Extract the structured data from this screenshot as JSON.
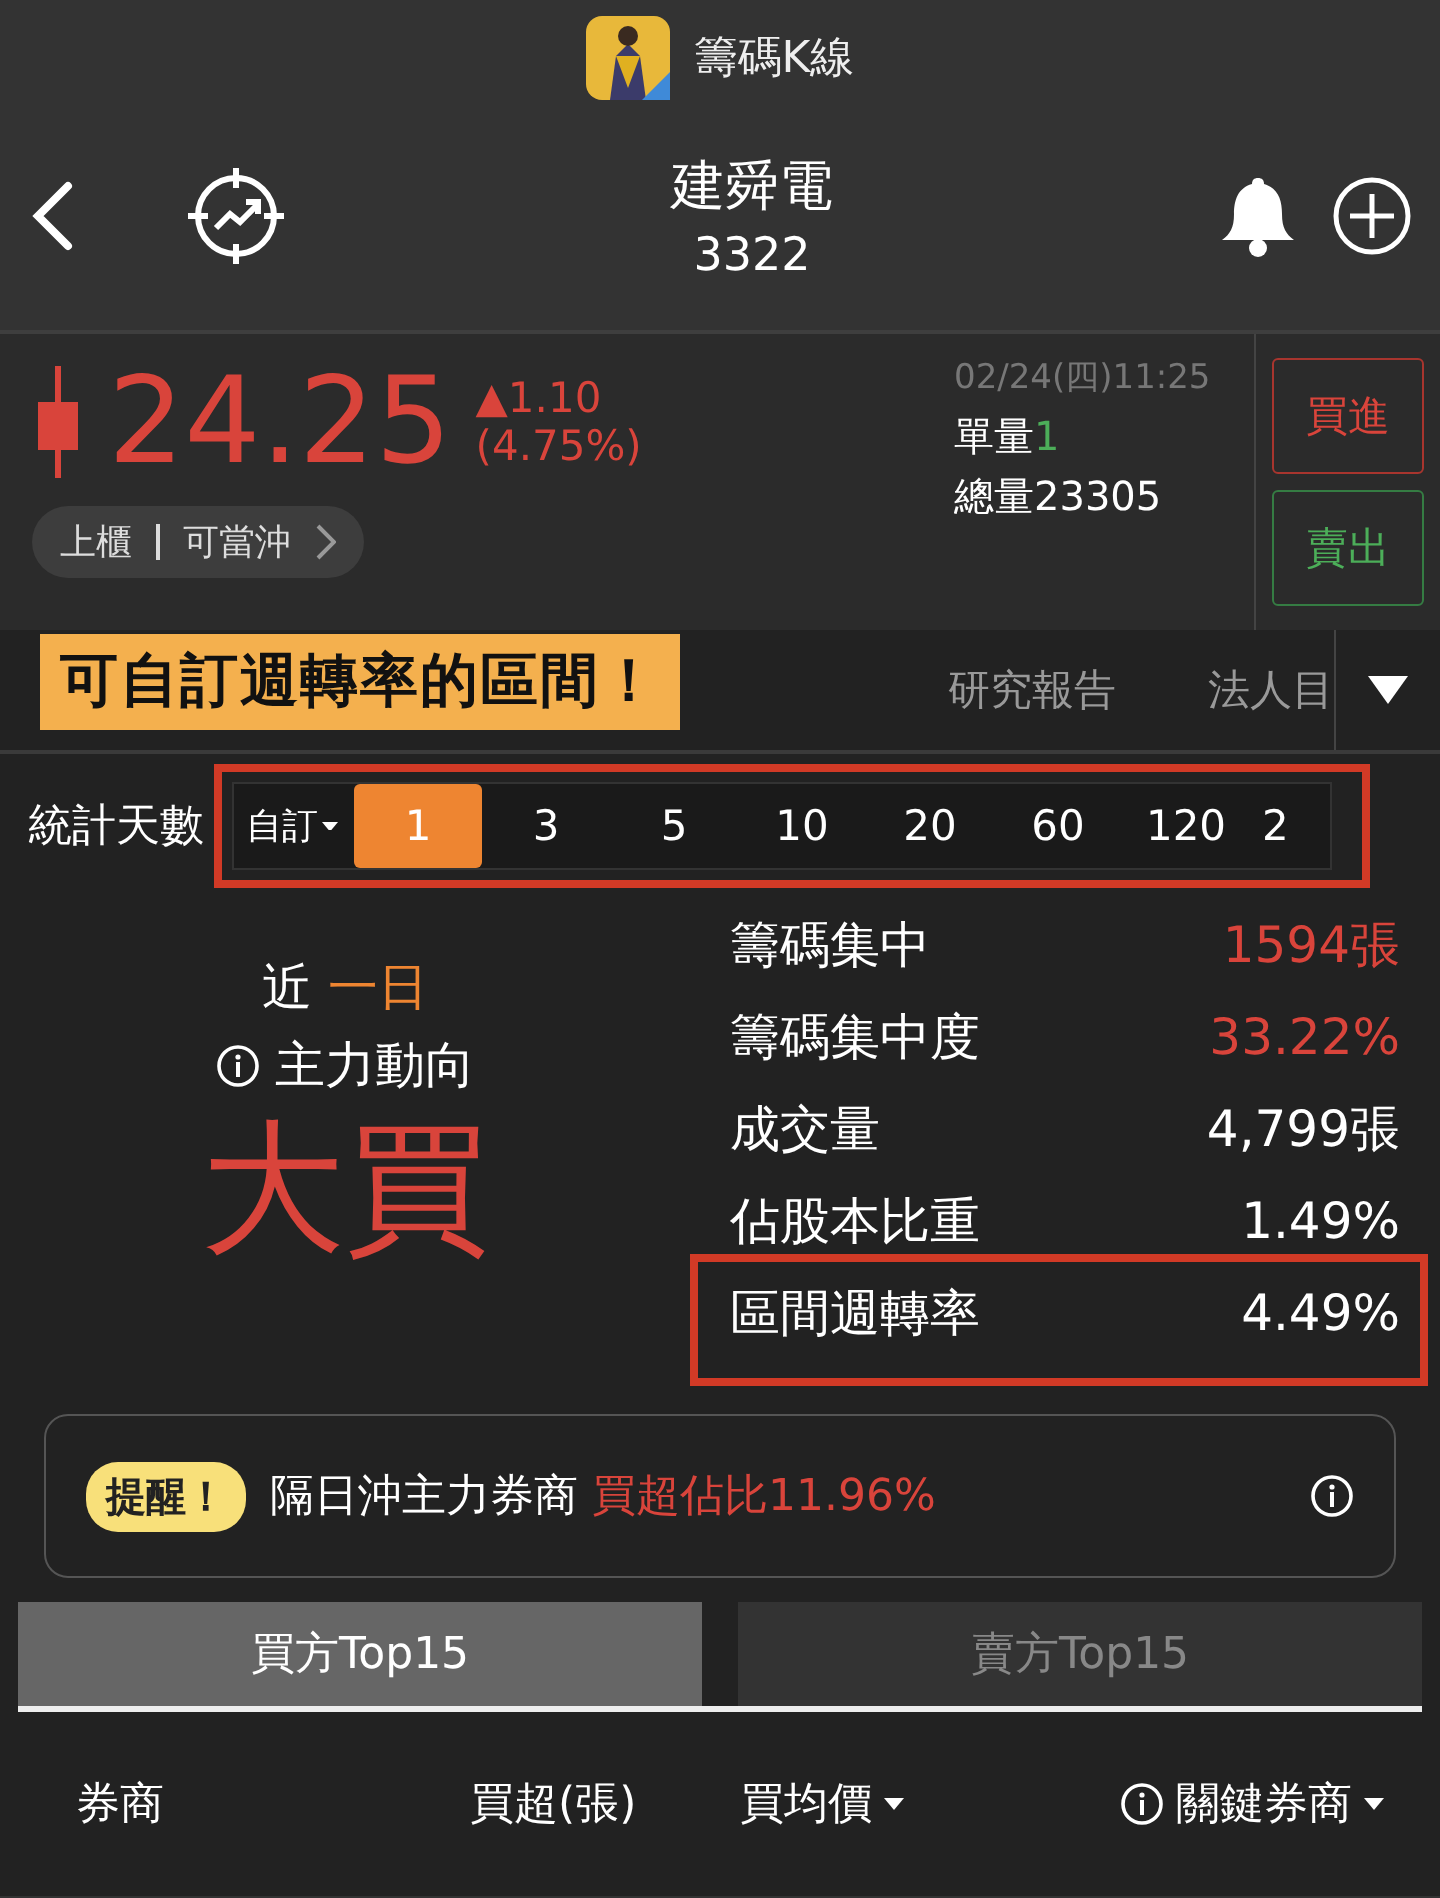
{
  "app_bar": {
    "title": "籌碼K線"
  },
  "stock": {
    "name": "建舜電",
    "code": "3322"
  },
  "quote": {
    "price": "24.25",
    "change": "▲1.10",
    "change_pct": "(4.75%)",
    "time": "02/24(四)11:25",
    "unit_volume_label": "單量",
    "unit_volume": "1",
    "total_volume_label": "總量",
    "total_volume": "23305",
    "market": "上櫃",
    "day_trade": "可當沖"
  },
  "actions": [
    {
      "label": "買進",
      "kind": "buy"
    },
    {
      "label": "賣出",
      "kind": "sell"
    }
  ],
  "tabs": [
    {
      "label": "研究報告",
      "selected": false
    },
    {
      "label": "法人目",
      "selected": false
    }
  ],
  "callout": "可自訂週轉率的區間！",
  "period": {
    "label": "統計天數",
    "custom": "自訂",
    "highlighted": true,
    "options": [
      {
        "label": "1",
        "selected": true
      },
      {
        "label": "3",
        "selected": false
      },
      {
        "label": "5",
        "selected": false
      },
      {
        "label": "10",
        "selected": false
      },
      {
        "label": "20",
        "selected": false
      },
      {
        "label": "60",
        "selected": false
      },
      {
        "label": "120",
        "selected": false
      },
      {
        "label": "2",
        "selected": false
      }
    ]
  },
  "summary": {
    "prefix": "近",
    "period": "一日",
    "label": "主力動向",
    "verdict": "大買"
  },
  "stats": [
    {
      "label": "籌碼集中",
      "value": "1594張",
      "kind": "up",
      "highlighted": false
    },
    {
      "label": "籌碼集中度",
      "value": "33.22%",
      "kind": "up",
      "highlighted": false
    },
    {
      "label": "成交量",
      "value": "4,799張",
      "kind": "plain",
      "highlighted": false
    },
    {
      "label": "佔股本比重",
      "value": "1.49%",
      "kind": "plain",
      "highlighted": false
    },
    {
      "label": "區間週轉率",
      "value": "4.49%",
      "kind": "plain",
      "highlighted": true
    }
  ],
  "alert": {
    "badge": "提醒！",
    "text": "隔日沖主力券商",
    "emphasis": "買超佔比11.96%"
  },
  "side_tabs": [
    {
      "label": "買方Top15",
      "selected": true
    },
    {
      "label": "賣方Top15",
      "selected": false
    }
  ],
  "columns": [
    {
      "label": "券商",
      "sortable": false,
      "info": false
    },
    {
      "label": "買超(張)",
      "sortable": false,
      "info": false
    },
    {
      "label": "買均價",
      "sortable": true,
      "info": false
    },
    {
      "label": "關鍵券商",
      "sortable": true,
      "info": true
    }
  ]
}
